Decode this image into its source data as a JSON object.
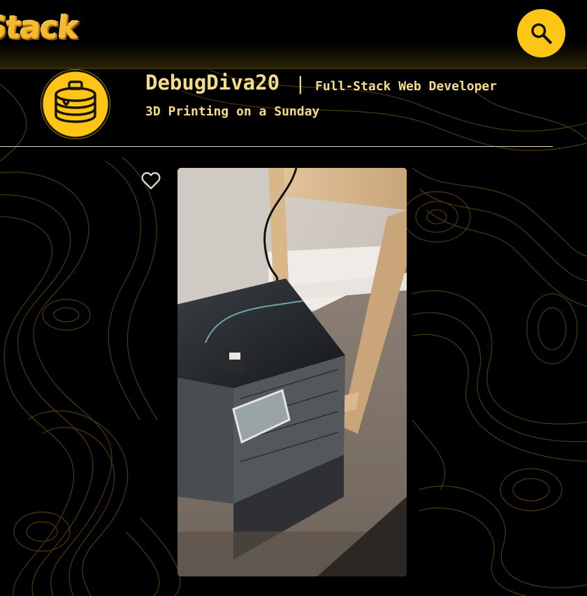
{
  "header": {
    "logo_text": "Stack",
    "search_icon": "search-icon",
    "colors": {
      "accent": "#fdc516",
      "logo": "#f7b930",
      "background": "#000000"
    }
  },
  "profile": {
    "username": "DebugDiva20",
    "separator": "|",
    "role": "Full-Stack Web Developer",
    "avatar_icon": "pancake-stack-icon"
  },
  "post": {
    "title": "3D Printing on a Sunday",
    "like_icon": "heart-outline-icon",
    "photo_subject": "3D printer next to a wooden table"
  },
  "colors": {
    "text": "#f3dc8a",
    "divider": "#d9d2bf",
    "contour": "#6e5213"
  }
}
